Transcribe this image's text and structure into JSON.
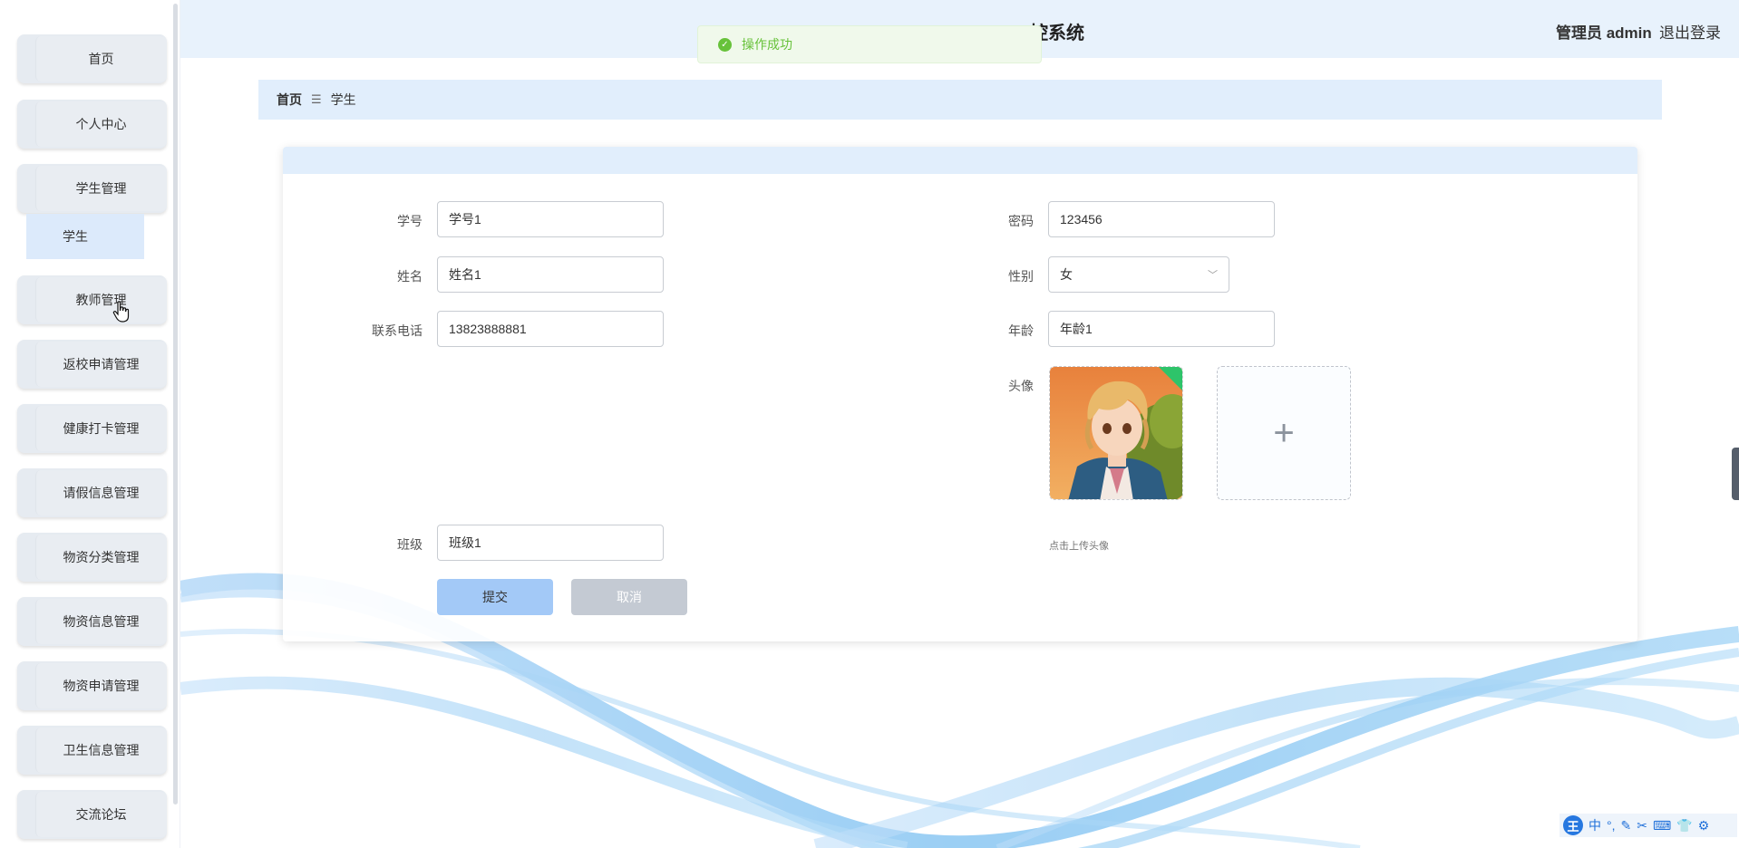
{
  "header": {
    "system_title": "控系统",
    "user_label": "管理员 admin",
    "logout": "退出登录"
  },
  "toast": {
    "message": "操作成功",
    "icon": "check-circle-icon",
    "color": "#67c23a"
  },
  "sidebar": {
    "items": [
      {
        "label": "首页"
      },
      {
        "label": "个人中心"
      },
      {
        "label": "学生管理"
      },
      {
        "label": "教师管理"
      },
      {
        "label": "返校申请管理"
      },
      {
        "label": "健康打卡管理"
      },
      {
        "label": "请假信息管理"
      },
      {
        "label": "物资分类管理"
      },
      {
        "label": "物资信息管理"
      },
      {
        "label": "物资申请管理"
      },
      {
        "label": "卫生信息管理"
      },
      {
        "label": "交流论坛"
      }
    ],
    "sub_item": {
      "label": "学生"
    }
  },
  "breadcrumb": {
    "home": "首页",
    "separator": "☰",
    "current": "学生"
  },
  "form": {
    "student_id": {
      "label": "学号",
      "value": "学号1"
    },
    "password": {
      "label": "密码",
      "value": "123456"
    },
    "name": {
      "label": "姓名",
      "value": "姓名1"
    },
    "gender": {
      "label": "性别",
      "value": "女"
    },
    "phone": {
      "label": "联系电话",
      "value": "13823888881"
    },
    "age": {
      "label": "年龄",
      "value": "年龄1"
    },
    "avatar": {
      "label": "头像",
      "tip": "点击上传头像"
    },
    "class_name": {
      "label": "班级",
      "value": "班级1"
    },
    "submit": "提交",
    "cancel": "取消"
  },
  "ime_bar": {
    "logo": "王",
    "mode": "中"
  },
  "colors": {
    "accent": "#a3c9f7",
    "header_bg": "#e8f2fc",
    "success": "#67c23a"
  }
}
